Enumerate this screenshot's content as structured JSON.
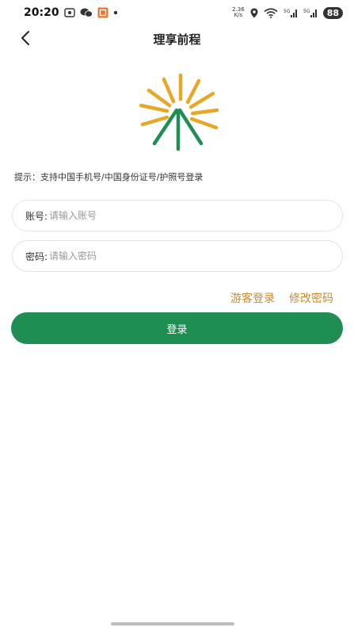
{
  "status_bar": {
    "time": "20:20",
    "net_speed_value": "2.36",
    "net_speed_unit": "K/s",
    "signal1_label": "5G",
    "signal2_label": "5G",
    "battery": "88"
  },
  "header": {
    "title": "理享前程"
  },
  "hint": "提示：支持中国手机号/中国身份证号/护照号登录",
  "account": {
    "label": "账号:",
    "placeholder": "请输入账号"
  },
  "password": {
    "label": "密码:",
    "placeholder": "请输入密码"
  },
  "links": {
    "guest_login": "游客登录",
    "change_password": "修改密码"
  },
  "login_button": "登录",
  "colors": {
    "primary_green": "#1e8e53",
    "accent_orange": "#c98a36",
    "logo_yellow": "#e6a826"
  }
}
